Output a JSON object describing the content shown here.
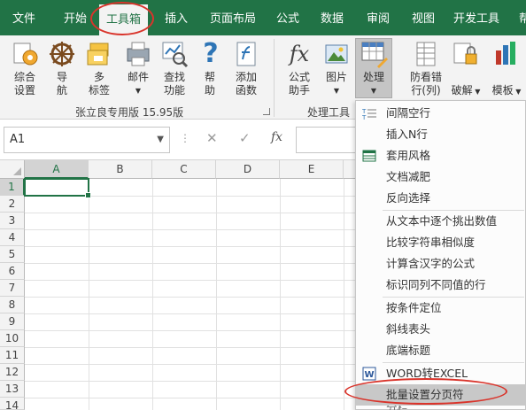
{
  "tabs": [
    "文件",
    "开始",
    "工具箱",
    "插入",
    "页面布局",
    "公式",
    "数据",
    "审阅",
    "视图",
    "开发工具",
    "帮"
  ],
  "ribbon": {
    "buttons": {
      "overview": [
        "综合",
        "设置"
      ],
      "nav": [
        "导",
        "航"
      ],
      "multi_tab": [
        "多",
        "标签"
      ],
      "mail": [
        "邮件"
      ],
      "find": [
        "查找",
        "功能"
      ],
      "help": [
        "帮",
        "助"
      ],
      "add_func": [
        "添加",
        "函数"
      ],
      "formula_helper": [
        "公式",
        "助手"
      ],
      "picture": [
        "图片"
      ],
      "process": [
        "处理"
      ],
      "anti_error": [
        "防看错",
        "行(列)"
      ],
      "crack": [
        "破解"
      ],
      "template": [
        "模板"
      ]
    },
    "group_labels": {
      "main": "张立良专用版 15.95版",
      "tools": "处理工具"
    },
    "icon_glyphs": {
      "fx": "fx",
      "help": "?"
    }
  },
  "formula_bar": {
    "namebox": "A1",
    "dots": "⋮",
    "cancel": "✕",
    "enter": "✓",
    "fx": "fx"
  },
  "grid": {
    "columns": [
      "A",
      "B",
      "C",
      "D",
      "E"
    ],
    "rows": [
      "1",
      "2",
      "3",
      "4",
      "5",
      "6",
      "7",
      "8",
      "9",
      "10",
      "11",
      "12",
      "13",
      "14"
    ],
    "active_cell": "A1"
  },
  "menu": {
    "items": [
      "间隔空行",
      "插入N行",
      "套用风格",
      "文档减肥",
      "反向选择",
      "从文本中逐个挑出数值",
      "比较字符串相似度",
      "计算含汉字的公式",
      "标识同列不同值的行",
      "按条件定位",
      "斜线表头",
      "底端标题",
      "WORD转EXCEL",
      "批量设置分页符",
      "分栏"
    ],
    "highlighted": "批量设置分页符"
  },
  "colors": {
    "excel_green": "#217346",
    "annotation_red": "#d9342b",
    "ribbon_bg": "#f3f3f3"
  }
}
